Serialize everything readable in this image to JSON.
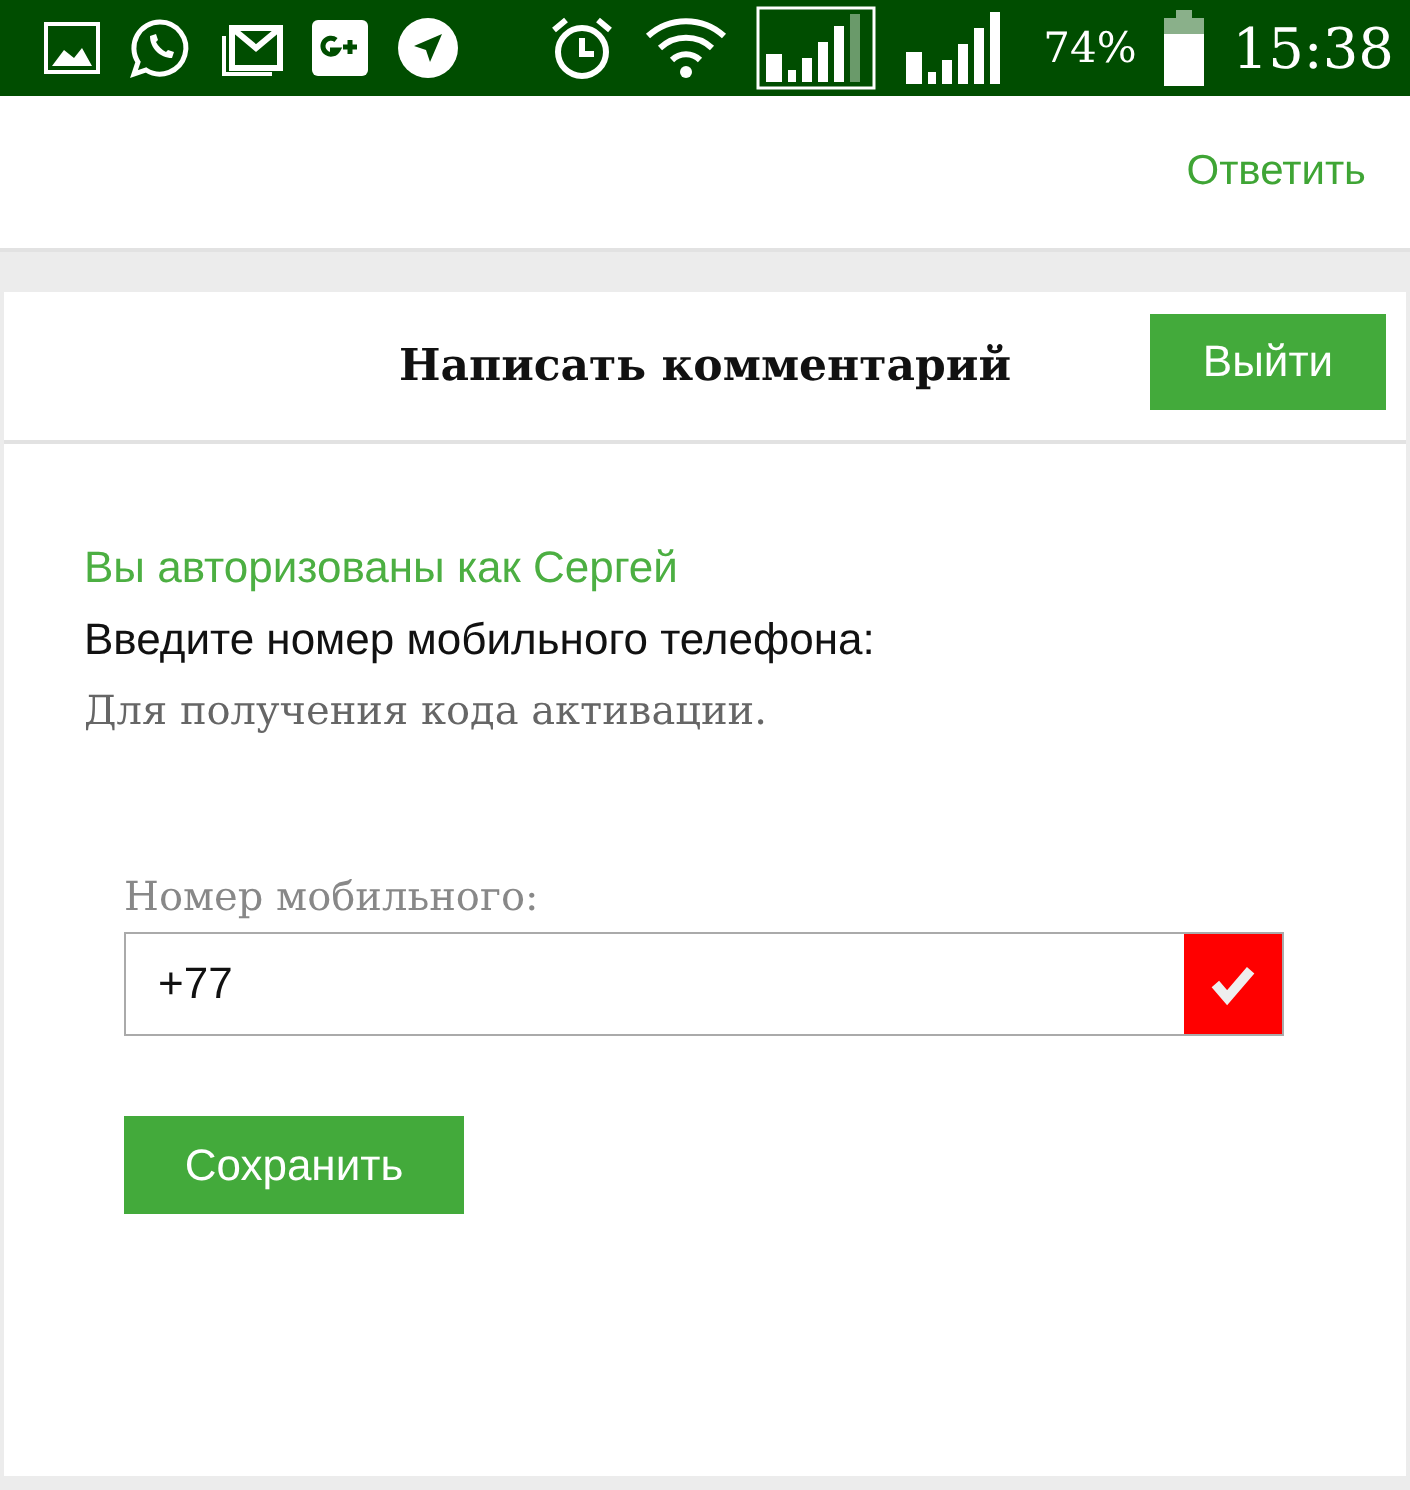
{
  "status_bar": {
    "battery": "74%",
    "time": "15:38"
  },
  "previous_comment": {
    "reply_link": "Ответить"
  },
  "comment_form": {
    "title": "Написать комментарий",
    "logout_button": "Выйти",
    "auth_note": "Вы авторизованы как Сергей",
    "prompt": "Введите номер мобильного телефона:",
    "hint": "Для получения кода активации.",
    "phone_label": "Номер мобильного:",
    "phone_value": "+77",
    "phone_valid": false,
    "save_button": "Сохранить"
  }
}
